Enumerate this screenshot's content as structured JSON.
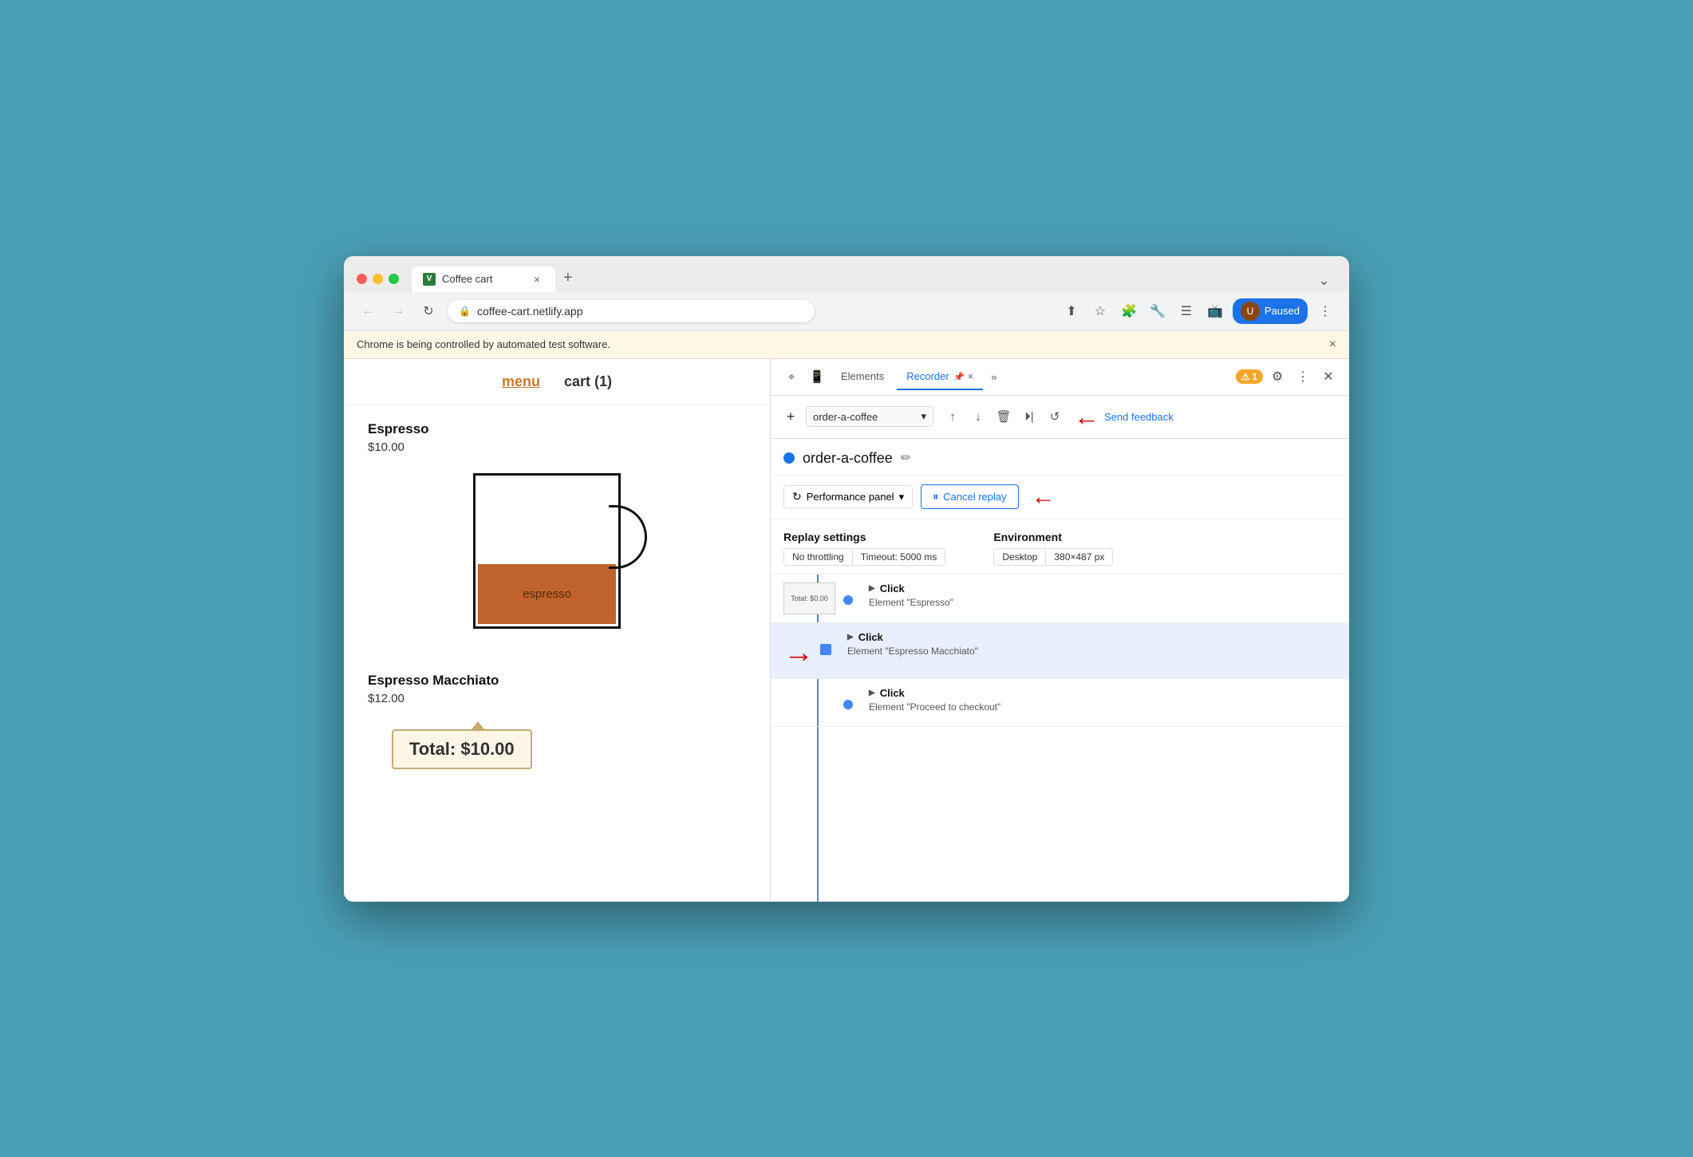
{
  "browser": {
    "tab_title": "Coffee cart",
    "tab_favicon": "V",
    "address": "coffee-cart.netlify.app",
    "paused_label": "Paused",
    "new_tab_icon": "+",
    "close_tab_icon": "×"
  },
  "automation_banner": {
    "text": "Chrome is being controlled by automated test software.",
    "close_icon": "×"
  },
  "website": {
    "nav_menu": "menu",
    "nav_cart": "cart (1)",
    "product1_name": "Espresso",
    "product1_price": "$10.00",
    "product1_label": "espresso",
    "product2_name": "Espresso Macchiato",
    "product2_price": "$12.00",
    "total_label": "Total: $10.00"
  },
  "devtools": {
    "elements_tab": "Elements",
    "recorder_tab": "Recorder",
    "pin_icon": "📌",
    "close_icon": "×",
    "more_icon": "»",
    "badge_count": "1",
    "badge_icon": "⚠",
    "recording_name": "order-a-coffee",
    "recording_dot_color": "#1a73e8",
    "send_feedback": "Send feedback",
    "perf_panel_label": "Performance panel",
    "cancel_replay_label": "Cancel replay",
    "replay_settings_title": "Replay settings",
    "no_throttling_label": "No throttling",
    "timeout_label": "Timeout: 5000 ms",
    "environment_title": "Environment",
    "desktop_label": "Desktop",
    "resolution_label": "380×487 px",
    "toolbar": {
      "add_icon": "+",
      "select_text": "order-a-coffee",
      "upload_icon": "↑",
      "download_icon": "↓",
      "delete_icon": "🗑",
      "play_icon": "⏵",
      "replay_icon": "↺"
    },
    "timeline": [
      {
        "id": 1,
        "thumbnail": "Total: $0.00",
        "action": "Click",
        "detail": "Element \"Espresso\"",
        "highlighted": false
      },
      {
        "id": 2,
        "thumbnail": null,
        "action": "Click",
        "detail": "Element \"Espresso Macchiato\"",
        "highlighted": true
      },
      {
        "id": 3,
        "thumbnail": null,
        "action": "Click",
        "detail": "Element \"Proceed to checkout\"",
        "highlighted": false
      }
    ]
  }
}
